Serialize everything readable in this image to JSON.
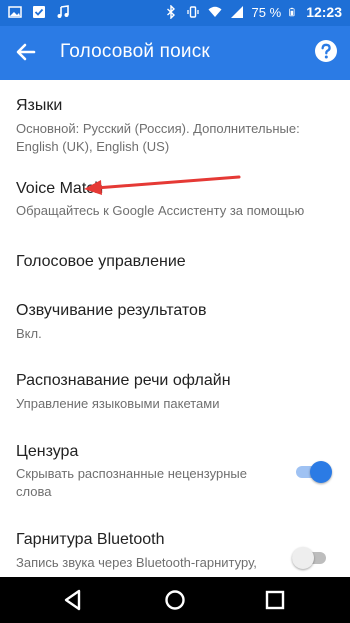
{
  "status_bar": {
    "battery": "75 %",
    "time": "12:23",
    "left_icons": [
      "image-icon",
      "checkmark-icon",
      "music-icon"
    ],
    "right_icons": [
      "bluetooth-icon",
      "vibrate-icon",
      "wifi-icon",
      "signal-icon",
      "battery-icon"
    ]
  },
  "app_bar": {
    "title": "Голосовой поиск",
    "back_icon": "back-arrow-icon",
    "help_icon": "help-icon",
    "color": "#2b7be5"
  },
  "settings": [
    {
      "title": "Языки",
      "subtitle": "Основной: Русский (Россия). Дополнительные: English (UK), English (US)"
    },
    {
      "title": "Voice Match",
      "subtitle": "Обращайтесь к Google Ассистенту за помощью"
    },
    {
      "title": "Голосовое управление"
    },
    {
      "title": "Озвучивание результатов",
      "subtitle": "Вкл."
    },
    {
      "title": "Распознавание речи офлайн",
      "subtitle": "Управление языковыми пакетами"
    },
    {
      "title": "Цензура",
      "subtitle": "Скрывать распознанные нецензурные слова",
      "toggle": true
    },
    {
      "title": "Гарнитура Bluetooth",
      "subtitle": "Запись звука через Bluetooth-гарнитуру, если это возможно",
      "toggle": false
    }
  ],
  "annotation": {
    "arrow_color": "#e53935"
  },
  "nav_bar": {
    "buttons": [
      "back-triangle-icon",
      "home-circle-icon",
      "recents-square-icon"
    ]
  }
}
